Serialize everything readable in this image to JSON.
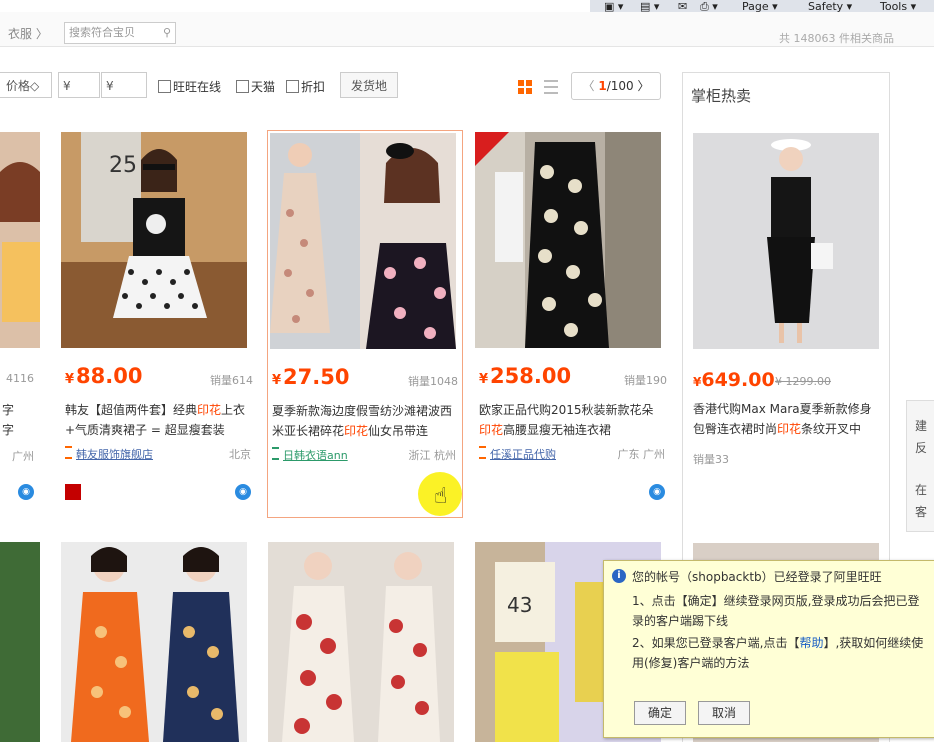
{
  "ie_toolbar": {
    "page": "Page ▾",
    "safety": "Safety ▾",
    "tools": "Tools ▾"
  },
  "search": {
    "crumb": "衣服 〉",
    "placeholder": "搜索符合宝贝",
    "right_text": "共 148063 件相关商品"
  },
  "filters": {
    "price_label": "价格◇",
    "price_min": "¥",
    "price_max": "¥",
    "wangwang": "旺旺在线",
    "tmall": "天猫",
    "discount": "折扣",
    "ship_from": "发货地",
    "page_current": "1",
    "page_total": "/100",
    "prev": "〈",
    "next": "〉"
  },
  "products": [
    {
      "price": "",
      "sold": "4116",
      "title_a": "字",
      "title_b": "字",
      "shop": "",
      "location": "广州"
    },
    {
      "price": "88.00",
      "sold": "销量614",
      "title_pre": "韩友【超值两件套】经典",
      "title_hl": "印花",
      "title_post": "上衣+气质清爽裙子 = 超显瘦套装",
      "shop": "韩友服饰旗舰店",
      "location": "北京"
    },
    {
      "price": "27.50",
      "sold": "销量1048",
      "title_pre": "夏季新款海边度假雪纺沙滩裙波西米亚长裙碎花",
      "title_hl": "印花",
      "title_post": "仙女吊带连",
      "shop": "日韩衣语ann",
      "location": "浙江 杭州"
    },
    {
      "price": "258.00",
      "sold": "销量190",
      "title_pre": "欧家正品代购2015秋装新款花朵",
      "title_hl": "印花",
      "title_post": "高腰显瘦无袖连衣裙",
      "shop": "任溪正品代购",
      "location": "广东 广州"
    }
  ],
  "sidebar": {
    "title": "掌柜热卖",
    "item": {
      "price": "649.00",
      "orig_price": "¥ 1299.00",
      "title_pre": "香港代购Max Mara夏季新款修身包臀连衣裙时尚",
      "title_hl": "印花",
      "title_post": "条纹开叉中",
      "sold": "销量33"
    }
  },
  "notification": {
    "message": "您的帐号（shopbacktb）已经登录了阿里旺旺",
    "line1": "1、点击【确定】继续登录网页版,登录成功后会把已登录的客户端踢下线",
    "line2_pre": "2、如果您已登录客户端,点击【",
    "line2_link": "帮助",
    "line2_post": "】,获取如何继续使用(修复)客户端的方法",
    "ok": "确定",
    "cancel": "取消"
  },
  "right_edge": {
    "a": "建",
    "b": "反",
    "c": "在",
    "d": "客"
  },
  "colors": {
    "price": "#ff4400",
    "highlight": "#ff4400",
    "popup_bg": "#ffffd6"
  },
  "currency": "¥"
}
